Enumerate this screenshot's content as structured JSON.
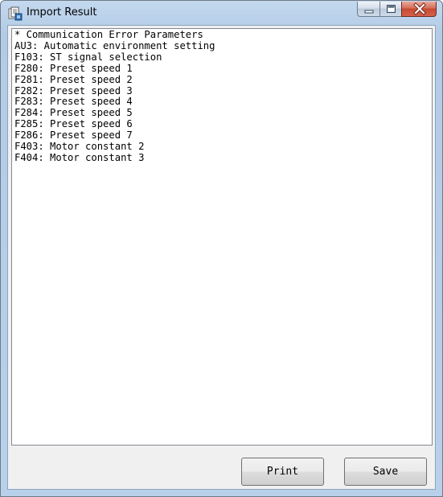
{
  "window": {
    "title": "Import Result",
    "app_icon": "app-document-icon"
  },
  "caption_buttons": {
    "minimize_icon": "minimize-icon",
    "maximize_icon": "maximize-icon",
    "close_icon": "close-icon"
  },
  "result_lines": [
    "* Communication Error Parameters",
    "AU3: Automatic environment setting",
    "F103: ST signal selection",
    "F280: Preset speed 1",
    "F281: Preset speed 2",
    "F282: Preset speed 3",
    "F283: Preset speed 4",
    "F284: Preset speed 5",
    "F285: Preset speed 6",
    "F286: Preset speed 7",
    "F403: Motor constant 2",
    "F404: Motor constant 3"
  ],
  "buttons": {
    "print_label": "Print",
    "save_label": "Save"
  },
  "colors": {
    "title_bar": "#b9d0ea",
    "close_button": "#c44a32",
    "client_bg": "#f0f0f0"
  }
}
